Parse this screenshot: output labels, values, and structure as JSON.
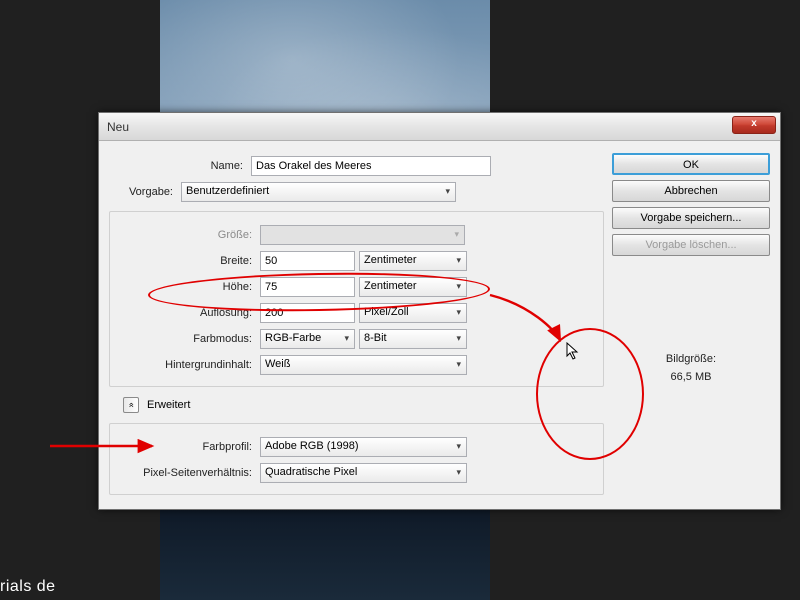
{
  "dialog": {
    "title": "Neu",
    "close": "x",
    "labels": {
      "name": "Name:",
      "preset": "Vorgabe:",
      "size": "Größe:",
      "width": "Breite:",
      "height": "Höhe:",
      "resolution": "Auflösung:",
      "colormode": "Farbmodus:",
      "bgcontent": "Hintergrundinhalt:",
      "advanced": "Erweitert",
      "colorprofile": "Farbprofil:",
      "pixelaspect": "Pixel-Seitenverhältnis:"
    },
    "values": {
      "name": "Das Orakel des Meeres",
      "preset": "Benutzerdefiniert",
      "size": "",
      "width": "50",
      "width_unit": "Zentimeter",
      "height": "75",
      "height_unit": "Zentimeter",
      "resolution": "200",
      "resolution_unit": "Pixel/Zoll",
      "colormode": "RGB-Farbe",
      "bitdepth": "8-Bit",
      "bgcontent": "Weiß",
      "colorprofile": "Adobe RGB (1998)",
      "pixelaspect": "Quadratische Pixel",
      "adv_toggle": "«"
    },
    "buttons": {
      "ok": "OK",
      "cancel": "Abbrechen",
      "save_preset": "Vorgabe speichern...",
      "delete_preset": "Vorgabe löschen..."
    },
    "imgsize": {
      "label": "Bildgröße:",
      "value": "66,5 MB"
    }
  },
  "watermark": "rials de"
}
